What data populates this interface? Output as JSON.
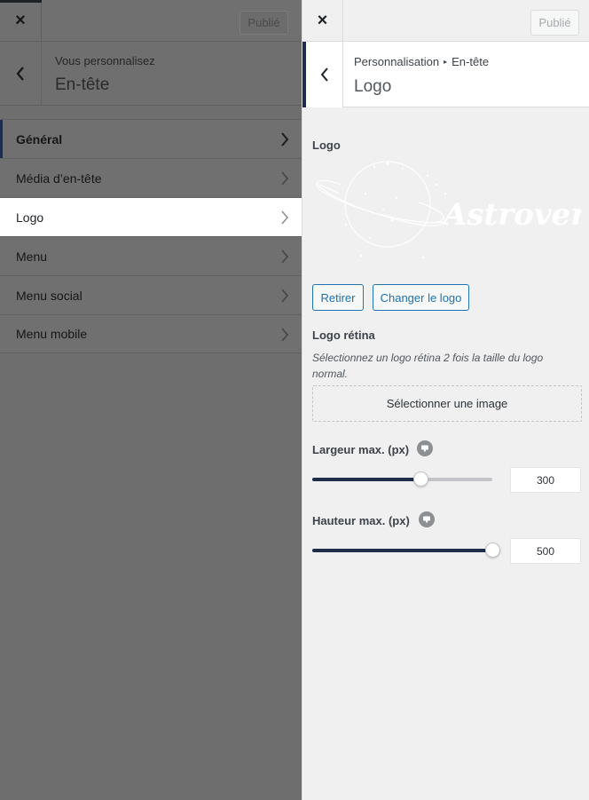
{
  "left_panel": {
    "close_label": "×",
    "publish_label": "Publié",
    "subtitle": "Vous personnalisez",
    "title": "En-tête",
    "menu_items": [
      {
        "label": "Général"
      },
      {
        "label": "Média d’en-tête"
      },
      {
        "label": "Logo"
      },
      {
        "label": "Menu"
      },
      {
        "label": "Menu social"
      },
      {
        "label": "Menu mobile"
      }
    ]
  },
  "right_panel": {
    "close_label": "×",
    "publish_label": "Publié",
    "breadcrumb": {
      "root": "Personnalisation",
      "separator": "▸",
      "current": "En-tête"
    },
    "title": "Logo",
    "logo_section_label": "Logo",
    "logo_text": "Astroverse",
    "remove_button": "Retirer",
    "change_button": "Changer le logo",
    "retina_label": "Logo rétina",
    "retina_description": "Sélectionnez un logo rétina 2 fois la taille du logo normal.",
    "select_image_button": "Sélectionner une image",
    "max_width": {
      "label": "Largeur max. (px)",
      "value": "300",
      "level": 0.6
    },
    "max_height": {
      "label": "Hauteur max. (px)",
      "value": "500",
      "level": 1.0
    }
  },
  "colors": {
    "accent": "#1d2d4a",
    "link": "#2271b1",
    "panel_bg": "#f0f0f1",
    "overlay": "#6e6e6e"
  },
  "icons": {
    "close": "close-icon",
    "back": "chevron-left-icon",
    "chevron": "chevron-right-icon",
    "help": "help-icon"
  }
}
